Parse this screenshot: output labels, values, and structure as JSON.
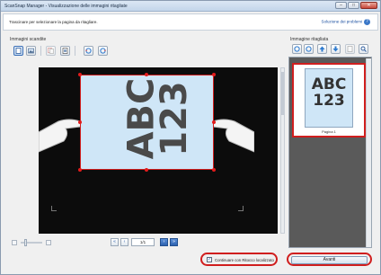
{
  "window": {
    "title": "ScanSnap Manager - Visualizzazione delle immagini ritagliate"
  },
  "infobar": {
    "message": "Trascinare per selezionare la pagina da ritagliare.",
    "help_link": "Soluzione dei problemi"
  },
  "left": {
    "label": "Immagini scandite"
  },
  "right": {
    "label": "Immagine ritagliata",
    "thumbnail": {
      "line1": "ABC",
      "line2": "123",
      "caption": "Pagina 1"
    }
  },
  "scan": {
    "line1": "ABC",
    "line2": "123"
  },
  "pager": {
    "value": "1/1"
  },
  "footer": {
    "checkbox_label": "Continuare con Ritocco localizzato",
    "checkbox_checked": true,
    "next_button": "Avanti"
  },
  "colors": {
    "highlight": "#d01e1e",
    "scan_background": "#0c0c0c",
    "page_fill": "#cfe6f7"
  }
}
